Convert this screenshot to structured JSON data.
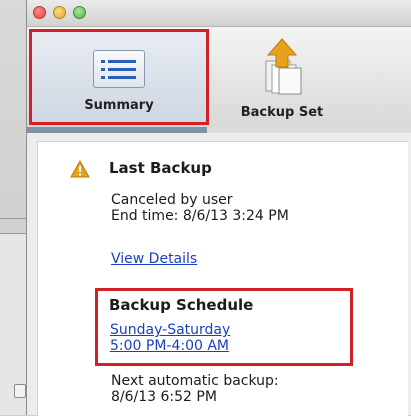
{
  "toolbar": {
    "summary_label": "Summary",
    "backupset_label": "Backup Set"
  },
  "last_backup": {
    "heading": "Last Backup",
    "status": "Canceled by user",
    "end_time": "End time: 8/6/13 3:24 PM",
    "details_link": "View Details"
  },
  "schedule": {
    "heading": "Backup Schedule",
    "days": "Sunday-Saturday",
    "hours": "5:00 PM-4:00 AM"
  },
  "next_backup": {
    "label": "Next automatic backup:",
    "time": "8/6/13 6:52 PM"
  },
  "icons": {
    "summary": "list-icon",
    "backupset": "upload-documents-icon",
    "warning": "warning-icon"
  },
  "colors": {
    "highlight": "#d32027",
    "link": "#1a3fc4",
    "warning": "#e8a21b"
  }
}
